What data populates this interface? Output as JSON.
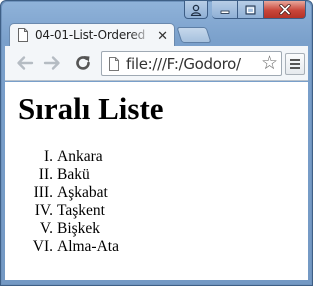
{
  "browser": {
    "tab_title": "04-01-List-Ordered",
    "tab_close": "✕",
    "address": "file:///F:/Godoro/",
    "star": "☆"
  },
  "page": {
    "heading": "Sıralı Liste",
    "list": [
      {
        "marker": "I.",
        "text": "Ankara"
      },
      {
        "marker": "II.",
        "text": "Bakü"
      },
      {
        "marker": "III.",
        "text": "Aşkabat"
      },
      {
        "marker": "IV.",
        "text": "Taşkent"
      },
      {
        "marker": "V.",
        "text": "Bişkek"
      },
      {
        "marker": "VI.",
        "text": "Alma-Ata"
      }
    ]
  }
}
